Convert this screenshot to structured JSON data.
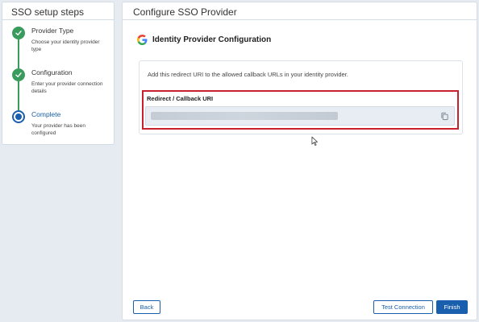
{
  "sidebar": {
    "title": "SSO setup steps",
    "steps": [
      {
        "title": "Provider Type",
        "description": "Choose your identity provider type",
        "status": "complete"
      },
      {
        "title": "Configuration",
        "description": "Enter your provider connection details",
        "status": "complete"
      },
      {
        "title": "Complete",
        "description": "Your provider has been configured",
        "status": "current"
      }
    ]
  },
  "main": {
    "title": "Configure SSO Provider",
    "section_title": "Identity Provider Configuration",
    "provider_icon": "google-icon",
    "info_text": "Add this redirect URI to the allowed callback URLs in your identity provider.",
    "uri_label": "Redirect / Callback URI",
    "uri_value": ""
  },
  "footer": {
    "back_label": "Back",
    "test_connection_label": "Test Connection",
    "finish_label": "Finish"
  },
  "colors": {
    "primary": "#1a5fad",
    "success": "#3a9c5c",
    "highlight": "#c8202c",
    "background": "#e6ebf2"
  }
}
